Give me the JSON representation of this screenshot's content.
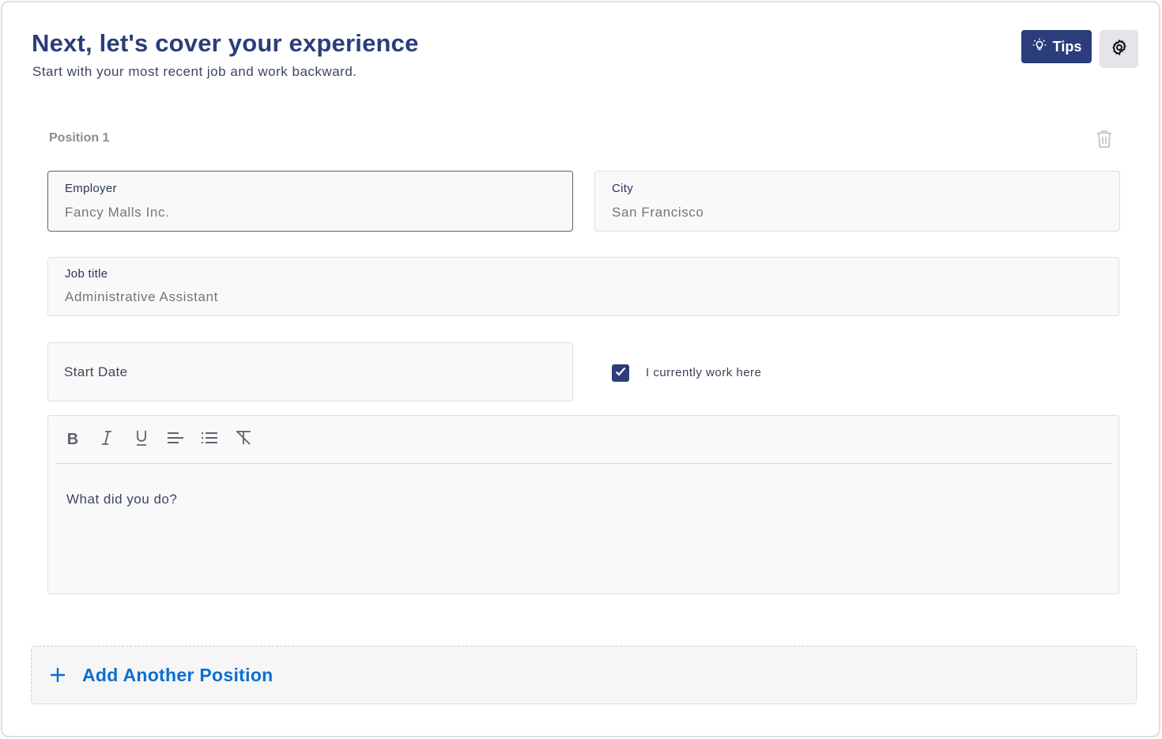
{
  "header": {
    "title": "Next, let's cover your experience",
    "subtitle": "Start with your most recent job and work backward.",
    "tips_label": "Tips"
  },
  "position": {
    "label": "Position 1",
    "employer": {
      "label": "Employer",
      "placeholder": "Fancy Malls Inc.",
      "value": ""
    },
    "city": {
      "label": "City",
      "placeholder": "San Francisco",
      "value": ""
    },
    "job_title": {
      "label": "Job title",
      "placeholder": "Administrative Assistant",
      "value": ""
    },
    "start_date": {
      "label": "Start Date"
    },
    "currently_work_here": {
      "label": "I currently work here",
      "checked": true
    },
    "description": {
      "placeholder": "What did you do?",
      "toolbar": [
        "bold",
        "italic",
        "underline",
        "align-left",
        "bulleted-list",
        "clear-format"
      ]
    }
  },
  "add_position_label": "Add Another Position",
  "colors": {
    "primary": "#2b3d7a",
    "link": "#0a6fd0",
    "muted": "#8a8c96"
  }
}
